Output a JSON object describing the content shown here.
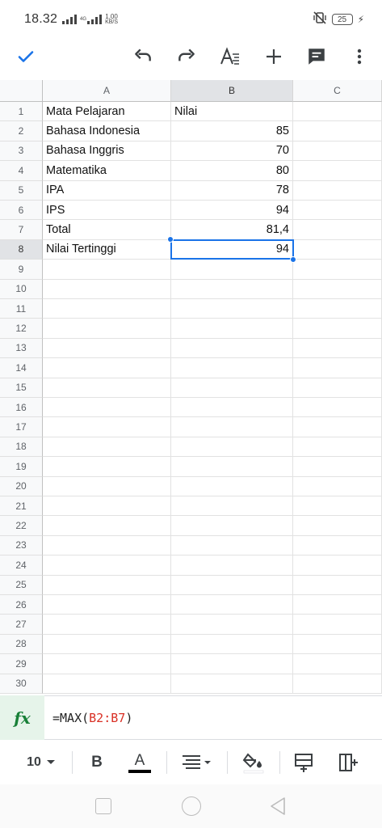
{
  "status_bar": {
    "time": "18.32",
    "network_speed_value": "1,00",
    "network_speed_unit": "KB/S",
    "network_type": "4G",
    "battery": "25"
  },
  "toolbar": {
    "icons": [
      "check-icon",
      "undo-icon",
      "redo-icon",
      "text-format-icon",
      "add-icon",
      "comment-icon",
      "more-vert-icon"
    ]
  },
  "sheet": {
    "columns": [
      "A",
      "B",
      "C"
    ],
    "selected_column": "B",
    "selected_row": 8,
    "rows": [
      {
        "n": "1",
        "a": "Mata Pelajaran",
        "b": "Nilai",
        "b_align": "left"
      },
      {
        "n": "2",
        "a": "Bahasa Indonesia",
        "b": "85",
        "b_align": "right"
      },
      {
        "n": "3",
        "a": "Bahasa Inggris",
        "b": "70",
        "b_align": "right"
      },
      {
        "n": "4",
        "a": "Matematika",
        "b": "80",
        "b_align": "right"
      },
      {
        "n": "5",
        "a": "IPA",
        "b": "78",
        "b_align": "right"
      },
      {
        "n": "6",
        "a": "IPS",
        "b": "94",
        "b_align": "right"
      },
      {
        "n": "7",
        "a": "Total",
        "b": "81,4",
        "b_align": "right"
      },
      {
        "n": "8",
        "a": "Nilai Tertinggi",
        "b": "94",
        "b_align": "right"
      },
      {
        "n": "9",
        "a": "",
        "b": ""
      },
      {
        "n": "10",
        "a": "",
        "b": ""
      },
      {
        "n": "11",
        "a": "",
        "b": ""
      },
      {
        "n": "12",
        "a": "",
        "b": ""
      },
      {
        "n": "13",
        "a": "",
        "b": ""
      },
      {
        "n": "14",
        "a": "",
        "b": ""
      },
      {
        "n": "15",
        "a": "",
        "b": ""
      },
      {
        "n": "16",
        "a": "",
        "b": ""
      },
      {
        "n": "17",
        "a": "",
        "b": ""
      },
      {
        "n": "18",
        "a": "",
        "b": ""
      },
      {
        "n": "19",
        "a": "",
        "b": ""
      },
      {
        "n": "20",
        "a": "",
        "b": ""
      },
      {
        "n": "21",
        "a": "",
        "b": ""
      },
      {
        "n": "22",
        "a": "",
        "b": ""
      },
      {
        "n": "23",
        "a": "",
        "b": ""
      },
      {
        "n": "24",
        "a": "",
        "b": ""
      },
      {
        "n": "25",
        "a": "",
        "b": ""
      },
      {
        "n": "26",
        "a": "",
        "b": ""
      },
      {
        "n": "27",
        "a": "",
        "b": ""
      },
      {
        "n": "28",
        "a": "",
        "b": ""
      },
      {
        "n": "29",
        "a": "",
        "b": ""
      },
      {
        "n": "30",
        "a": "",
        "b": ""
      }
    ]
  },
  "formula_bar": {
    "fx_label": "fx",
    "prefix": "=MAX(",
    "range": "B2:B7",
    "suffix": ")"
  },
  "format_bar": {
    "font_size": "10",
    "bold_label": "B",
    "text_color_label": "A"
  },
  "colors": {
    "accent": "#1a73e8",
    "formula_green": "#188038",
    "formula_ref_red": "#d93025"
  }
}
